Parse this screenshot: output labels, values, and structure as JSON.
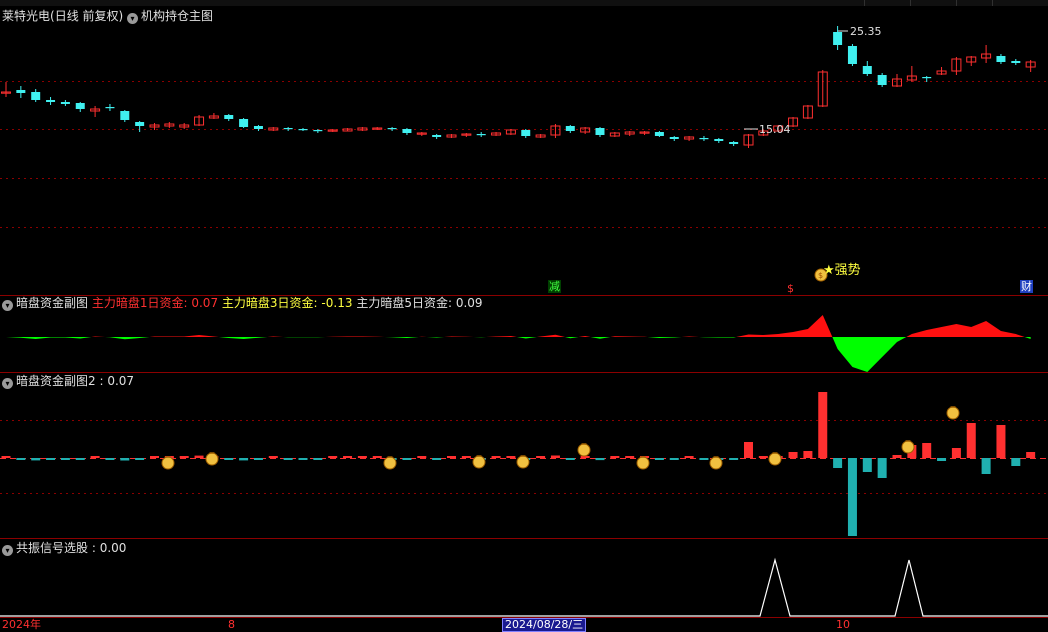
{
  "stock": {
    "name": "莱特光电",
    "mode": "(日线 前复权)"
  },
  "main_panel": {
    "indicator": "机构持仓主图",
    "high_label": "25.35",
    "low_label": "15.04",
    "signal_strong": "★强势",
    "tag_jian": "减",
    "tag_dollar": "$",
    "tag_cai": "财"
  },
  "panel2": {
    "title": "暗盘资金副图",
    "items": [
      {
        "label": "主力暗盘1日资金:",
        "value": "0.07"
      },
      {
        "label": "主力暗盘3日资金:",
        "value": "-0.13"
      },
      {
        "label": "主力暗盘5日资金:",
        "value": "0.09"
      }
    ]
  },
  "panel3": {
    "title": "暗盘资金副图2",
    "value": ": 0.07"
  },
  "panel4": {
    "title": "共振信号选股",
    "value": ": 0.00"
  },
  "axis": {
    "year": "2024年",
    "month1": "8",
    "cursor_date": "2024/08/28/三",
    "month2": "10"
  },
  "colors": {
    "up": "#ff3030",
    "down": "#40f0f0",
    "bg": "#000000",
    "grid": "#8b0000",
    "green_area": "#00ff00",
    "red_area": "#ff1010",
    "cyan_bar": "#20b0b0"
  },
  "candles": [
    [
      0.0,
      0.0,
      1.0,
      -0.5
    ],
    [
      0.2,
      -0.1,
      0.6,
      -0.6
    ],
    [
      0.0,
      -0.8,
      0.3,
      -1.0
    ],
    [
      -0.8,
      -1.0,
      -0.5,
      -1.3
    ],
    [
      -1.0,
      -1.2,
      -0.8,
      -1.4
    ],
    [
      -1.1,
      -1.7,
      -1.0,
      -2.0
    ],
    [
      -1.9,
      -1.7,
      -1.4,
      -2.5
    ],
    [
      -1.5,
      -1.6,
      -1.2,
      -1.9
    ],
    [
      -1.9,
      -2.8,
      -1.8,
      -3.0
    ],
    [
      -3.0,
      -3.4,
      -2.9,
      -4.0
    ],
    [
      -3.5,
      -3.3,
      -3.1,
      -3.8
    ],
    [
      -3.4,
      -3.2,
      -3.0,
      -3.6
    ],
    [
      -3.5,
      -3.3,
      -3.1,
      -3.7
    ],
    [
      -3.3,
      -2.5,
      -2.3,
      -3.4
    ],
    [
      -2.6,
      -2.4,
      -2.1,
      -2.7
    ],
    [
      -2.3,
      -2.7,
      -2.2,
      -2.9
    ],
    [
      -2.7,
      -3.5,
      -2.6,
      -3.6
    ],
    [
      -3.4,
      -3.7,
      -3.3,
      -3.9
    ],
    [
      -3.8,
      -3.6,
      -3.5,
      -3.9
    ],
    [
      -3.6,
      -3.7,
      -3.5,
      -3.9
    ],
    [
      -3.7,
      -3.8,
      -3.6,
      -3.9
    ],
    [
      -3.8,
      -3.9,
      -3.7,
      -4.1
    ],
    [
      -3.9,
      -3.8,
      -3.7,
      -4.0
    ],
    [
      -3.9,
      -3.7,
      -3.6,
      -3.9
    ],
    [
      -3.8,
      -3.6,
      -3.5,
      -3.9
    ],
    [
      -3.7,
      -3.6,
      -3.5,
      -3.8
    ],
    [
      -3.6,
      -3.7,
      -3.5,
      -3.9
    ],
    [
      -3.7,
      -4.1,
      -3.6,
      -4.3
    ],
    [
      -4.2,
      -4.1,
      -4.0,
      -4.4
    ],
    [
      -4.3,
      -4.5,
      -4.2,
      -4.7
    ],
    [
      -4.5,
      -4.3,
      -4.2,
      -4.6
    ],
    [
      -4.3,
      -4.2,
      -4.1,
      -4.5
    ],
    [
      -4.2,
      -4.3,
      -4.0,
      -4.5
    ],
    [
      -4.3,
      -4.1,
      -4.0,
      -4.4
    ],
    [
      -4.2,
      -3.8,
      -3.7,
      -4.3
    ],
    [
      -3.8,
      -4.4,
      -3.7,
      -4.6
    ],
    [
      -4.5,
      -4.3,
      -4.2,
      -4.6
    ],
    [
      -4.3,
      -3.4,
      -3.2,
      -4.6
    ],
    [
      -3.4,
      -3.9,
      -3.3,
      -4.1
    ],
    [
      -4.0,
      -3.6,
      -3.5,
      -4.2
    ],
    [
      -3.6,
      -4.3,
      -3.5,
      -4.5
    ],
    [
      -4.4,
      -4.1,
      -4.0,
      -4.5
    ],
    [
      -4.2,
      -4.0,
      -3.9,
      -4.4
    ],
    [
      -4.1,
      -4.0,
      -3.9,
      -4.3
    ],
    [
      -4.0,
      -4.4,
      -3.9,
      -4.5
    ],
    [
      -4.5,
      -4.7,
      -4.4,
      -4.9
    ],
    [
      -4.7,
      -4.5,
      -4.4,
      -4.9
    ],
    [
      -4.6,
      -4.7,
      -4.4,
      -4.9
    ],
    [
      -4.7,
      -4.9,
      -4.6,
      -5.1
    ],
    [
      -5.0,
      -5.2,
      -4.9,
      -5.4
    ],
    [
      -5.3,
      -4.3,
      -4.2,
      -5.6
    ],
    [
      -4.3,
      -3.9,
      -3.8,
      -4.4
    ],
    [
      -3.9,
      -3.4,
      -3.3,
      -4.0
    ],
    [
      -3.4,
      -2.6,
      -2.5,
      -3.5
    ],
    [
      -2.6,
      -1.4,
      -1.3,
      -2.7
    ],
    [
      -1.4,
      2.0,
      2.2,
      -1.5
    ],
    [
      6.0,
      4.7,
      6.6,
      4.2
    ],
    [
      4.6,
      2.8,
      4.8,
      2.6
    ],
    [
      2.6,
      1.8,
      3.1,
      1.6
    ],
    [
      1.7,
      0.7,
      1.9,
      0.5
    ],
    [
      0.6,
      1.3,
      1.8,
      0.5
    ],
    [
      1.2,
      1.6,
      2.6,
      1.0
    ],
    [
      1.5,
      1.4,
      1.6,
      1.0
    ],
    [
      1.8,
      2.1,
      2.5,
      1.7
    ],
    [
      2.1,
      3.3,
      3.5,
      1.7
    ],
    [
      3.0,
      3.5,
      3.6,
      2.6
    ],
    [
      3.4,
      3.8,
      4.7,
      2.9
    ],
    [
      3.6,
      3.0,
      3.8,
      2.8
    ],
    [
      3.1,
      2.9,
      3.3,
      2.7
    ],
    [
      2.5,
      3.0,
      3.2,
      2.0
    ]
  ]
}
